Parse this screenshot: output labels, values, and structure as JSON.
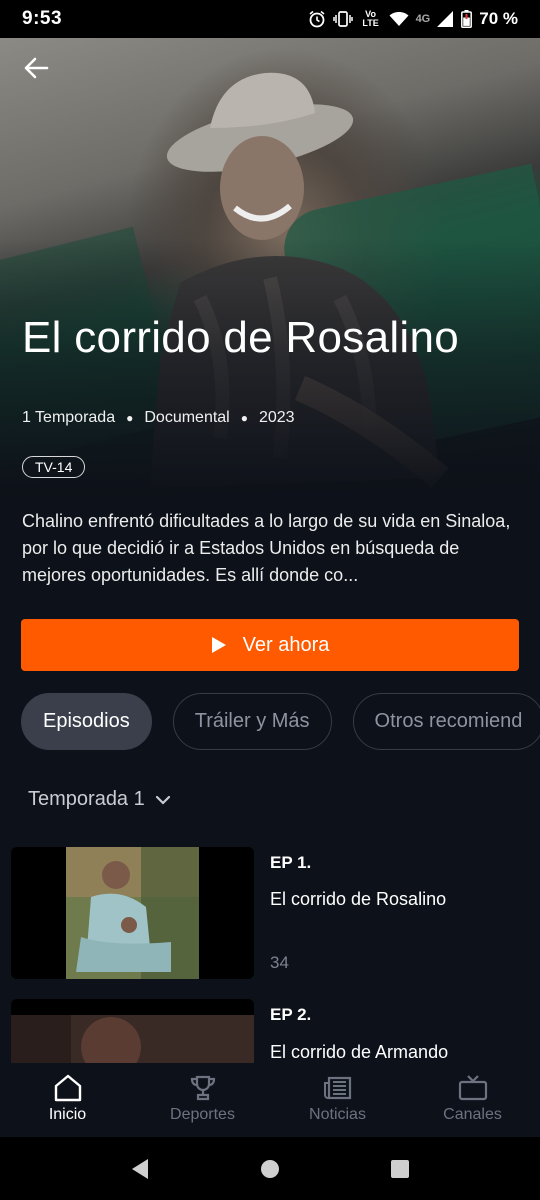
{
  "status_bar": {
    "time": "9:53",
    "network_label": "4G",
    "volte_label": "Vo LTE",
    "battery": "70 %"
  },
  "show": {
    "title": "El corrido de Rosalino",
    "seasons": "1 Temporada",
    "genre": "Documental",
    "year": "2023",
    "rating": "TV-14",
    "synopsis": "Chalino enfrentó dificultades a lo largo de su vida en Sinaloa, por lo que decidió ir a Estados Unidos en búsqueda de mejores oportunidades. Es allí donde co..."
  },
  "cta": {
    "label": "Ver ahora",
    "icon": "play-icon",
    "color": "#ff5a00"
  },
  "tabs": [
    {
      "label": "Episodios",
      "active": true
    },
    {
      "label": "Tráiler y Más",
      "active": false
    },
    {
      "label": "Otros recomiend",
      "active": false
    }
  ],
  "season_selector": {
    "label": "Temporada 1",
    "icon": "chevron-down-icon"
  },
  "episodes": [
    {
      "number": "EP 1.",
      "title": "El corrido de Rosalino",
      "duration": "34"
    },
    {
      "number": "EP 2.",
      "title": "El corrido de Armando",
      "duration": ""
    }
  ],
  "bottom_nav": [
    {
      "label": "Inicio",
      "icon": "home-icon",
      "active": true
    },
    {
      "label": "Deportes",
      "icon": "trophy-icon",
      "active": false
    },
    {
      "label": "Noticias",
      "icon": "newspaper-icon",
      "active": false
    },
    {
      "label": "Canales",
      "icon": "tv-icon",
      "active": false
    }
  ],
  "colors": {
    "background": "#0d1119",
    "accent": "#ff5a00",
    "inactive": "#6d7280"
  }
}
